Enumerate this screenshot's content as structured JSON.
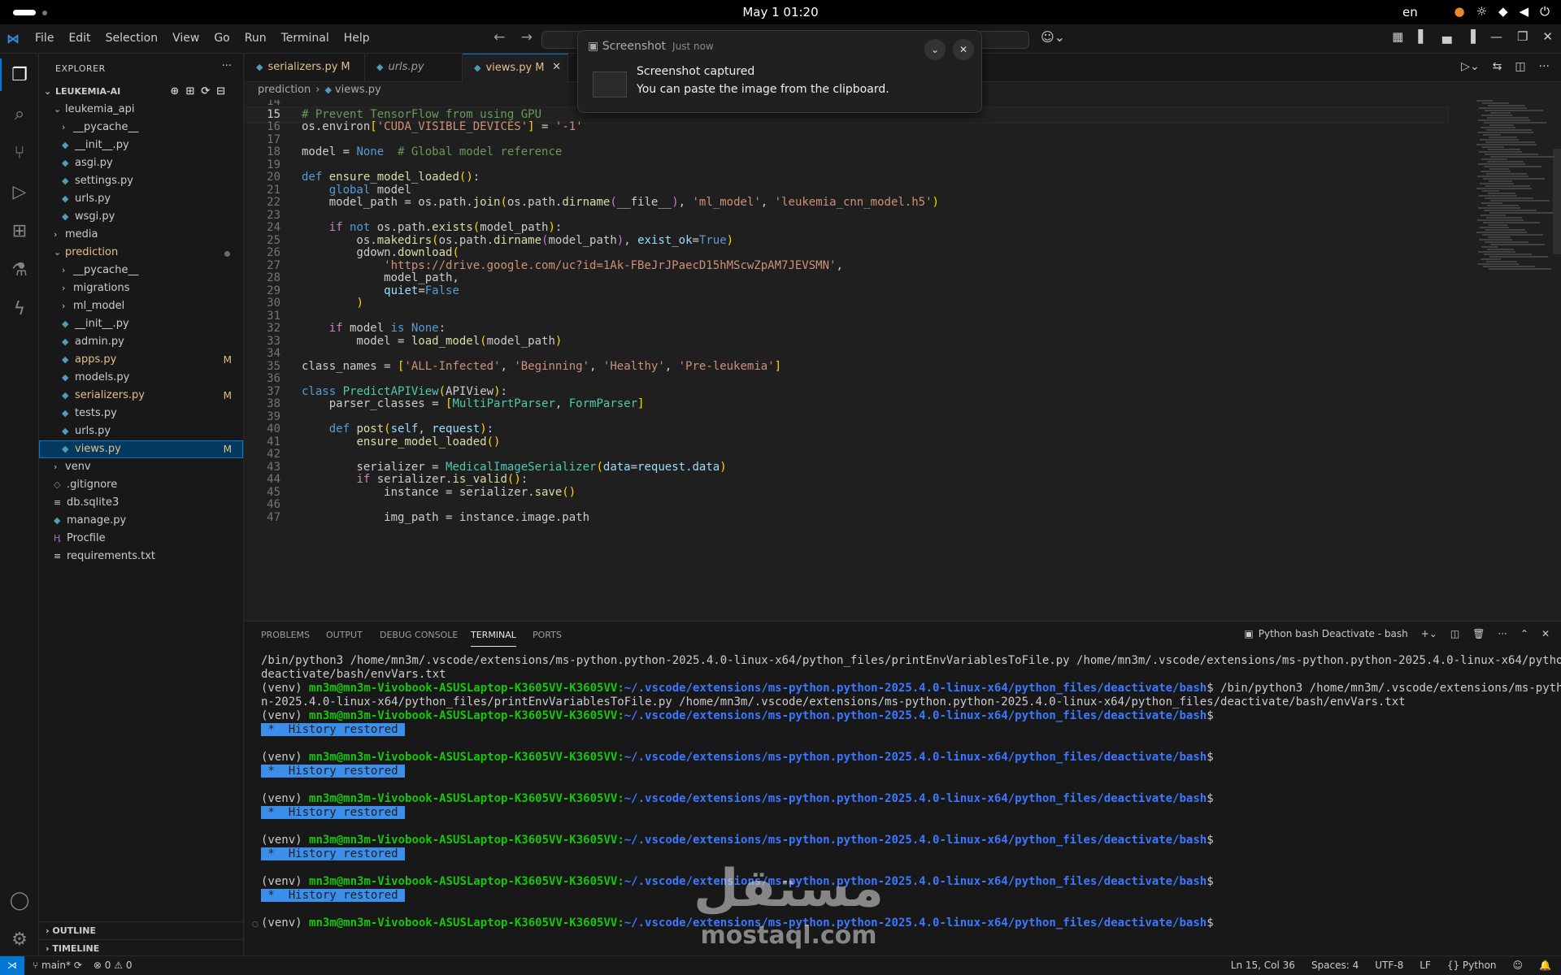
{
  "os": {
    "clock": "May 1  01:20",
    "lang": "en",
    "tray_icons": [
      "microphone-icon",
      "brightness-icon",
      "wifi-icon",
      "volume-icon",
      "power-icon"
    ]
  },
  "menu": [
    "File",
    "Edit",
    "Selection",
    "View",
    "Go",
    "Run",
    "Terminal",
    "Help"
  ],
  "sidebar": {
    "title": "EXPLORER",
    "root": "LEUKEMIA-AI",
    "items": [
      {
        "label": "leukemia_api",
        "depth": 1,
        "type": "folder-open"
      },
      {
        "label": "__pycache__",
        "depth": 2,
        "type": "folder"
      },
      {
        "label": "__init__.py",
        "depth": 2,
        "type": "py"
      },
      {
        "label": "asgi.py",
        "depth": 2,
        "type": "py"
      },
      {
        "label": "settings.py",
        "depth": 2,
        "type": "py"
      },
      {
        "label": "urls.py",
        "depth": 2,
        "type": "py"
      },
      {
        "label": "wsgi.py",
        "depth": 2,
        "type": "py"
      },
      {
        "label": "media",
        "depth": 1,
        "type": "folder"
      },
      {
        "label": "prediction",
        "depth": 1,
        "type": "folder-open",
        "status": "dot"
      },
      {
        "label": "__pycache__",
        "depth": 2,
        "type": "folder"
      },
      {
        "label": "migrations",
        "depth": 2,
        "type": "folder"
      },
      {
        "label": "ml_model",
        "depth": 2,
        "type": "folder"
      },
      {
        "label": "__init__.py",
        "depth": 2,
        "type": "py"
      },
      {
        "label": "admin.py",
        "depth": 2,
        "type": "py"
      },
      {
        "label": "apps.py",
        "depth": 2,
        "type": "py",
        "status": "M"
      },
      {
        "label": "models.py",
        "depth": 2,
        "type": "py"
      },
      {
        "label": "serializers.py",
        "depth": 2,
        "type": "py",
        "status": "M"
      },
      {
        "label": "tests.py",
        "depth": 2,
        "type": "py"
      },
      {
        "label": "urls.py",
        "depth": 2,
        "type": "py"
      },
      {
        "label": "views.py",
        "depth": 2,
        "type": "py",
        "status": "M",
        "selected": true
      },
      {
        "label": "venv",
        "depth": 1,
        "type": "folder"
      },
      {
        "label": ".gitignore",
        "depth": 1,
        "type": "git"
      },
      {
        "label": "db.sqlite3",
        "depth": 1,
        "type": "db"
      },
      {
        "label": "manage.py",
        "depth": 1,
        "type": "py"
      },
      {
        "label": "Procfile",
        "depth": 1,
        "type": "proc"
      },
      {
        "label": "requirements.txt",
        "depth": 1,
        "type": "txt"
      }
    ],
    "outline": "OUTLINE",
    "timeline": "TIMELINE"
  },
  "tabs": [
    {
      "label": "serializers.py",
      "modified": "M"
    },
    {
      "label": "urls.py",
      "modified": ""
    },
    {
      "label": "views.py",
      "modified": "M",
      "active": true
    }
  ],
  "breadcrumb": [
    "prediction",
    "views.py"
  ],
  "editor": {
    "current_line": 15,
    "lines": [
      {
        "n": "14",
        "code": ""
      },
      {
        "n": "15",
        "code": "# Prevent TensorFlow from using GPU"
      },
      {
        "n": "16",
        "code": "os.environ['CUDA_VISIBLE_DEVICES'] = '-1'"
      },
      {
        "n": "17",
        "code": ""
      },
      {
        "n": "18",
        "code": "model = None  # Global model reference"
      },
      {
        "n": "19",
        "code": ""
      },
      {
        "n": "20",
        "code": "def ensure_model_loaded():"
      },
      {
        "n": "21",
        "code": "    global model"
      },
      {
        "n": "22",
        "code": "    model_path = os.path.join(os.path.dirname(__file__), 'ml_model', 'leukemia_cnn_model.h5')"
      },
      {
        "n": "23",
        "code": ""
      },
      {
        "n": "24",
        "code": "    if not os.path.exists(model_path):"
      },
      {
        "n": "25",
        "code": "        os.makedirs(os.path.dirname(model_path), exist_ok=True)"
      },
      {
        "n": "26",
        "code": "        gdown.download("
      },
      {
        "n": "27",
        "code": "            'https://drive.google.com/uc?id=1Ak-FBeJrJPaecD15hMScwZpAM7JEVSMN',"
      },
      {
        "n": "28",
        "code": "            model_path,"
      },
      {
        "n": "29",
        "code": "            quiet=False"
      },
      {
        "n": "30",
        "code": "        )"
      },
      {
        "n": "31",
        "code": ""
      },
      {
        "n": "32",
        "code": "    if model is None:"
      },
      {
        "n": "33",
        "code": "        model = load_model(model_path)"
      },
      {
        "n": "34",
        "code": ""
      },
      {
        "n": "35",
        "code": "class_names = ['ALL-Infected', 'Beginning', 'Healthy', 'Pre-leukemia']"
      },
      {
        "n": "36",
        "code": ""
      },
      {
        "n": "37",
        "code": "class PredictAPIView(APIView):"
      },
      {
        "n": "38",
        "code": "    parser_classes = [MultiPartParser, FormParser]"
      },
      {
        "n": "39",
        "code": ""
      },
      {
        "n": "40",
        "code": "    def post(self, request):"
      },
      {
        "n": "41",
        "code": "        ensure_model_loaded()"
      },
      {
        "n": "42",
        "code": ""
      },
      {
        "n": "43",
        "code": "        serializer = MedicalImageSerializer(data=request.data)"
      },
      {
        "n": "44",
        "code": "        if serializer.is_valid():"
      },
      {
        "n": "45",
        "code": "            instance = serializer.save()"
      },
      {
        "n": "46",
        "code": ""
      },
      {
        "n": "47",
        "code": "            img_path = instance.image.path"
      }
    ]
  },
  "panel": {
    "tabs": [
      "PROBLEMS",
      "OUTPUT",
      "DEBUG CONSOLE",
      "TERMINAL",
      "PORTS"
    ],
    "active_tab": "TERMINAL",
    "terminal_name": "Python bash Deactivate - bash",
    "terminal": {
      "line1": "/bin/python3 /home/mn3m/.vscode/extensions/ms-python.python-2025.4.0-linux-x64/python_files/printEnvVariablesToFile.py /home/mn3m/.vscode/extensions/ms-python.python-2025.4.0-linux-x64/python_files/",
      "line2": "deactivate/bash/envVars.txt",
      "venv": "(venv) ",
      "user": "mn3m@mn3m-Vivobook-ASUSLaptop-K3605VV-K3605VV",
      "colon": ":",
      "path": "~/.vscode/extensions/ms-python.python-2025.4.0-linux-x64/python_files/deactivate/bash",
      "dollar": "$",
      "cmd_a": " /bin/python3 /home/mn3m/.vscode/extensions/ms-python.pytho",
      "cmd_b": "n-2025.4.0-linux-x64/python_files/printEnvVariablesToFile.py /home/mn3m/.vscode/extensions/ms-python.python-2025.4.0-linux-x64/python_files/deactivate/bash/envVars.txt",
      "history": " *  History restored "
    }
  },
  "notification": {
    "app": "Screenshot",
    "when": "Just now",
    "title": "Screenshot captured",
    "body": "You can paste the image from the clipboard."
  },
  "watermark": {
    "arabic": "مستقل",
    "latin": "mostaql.com"
  },
  "status": {
    "branch": "main*",
    "errors": "0",
    "warnings": "0",
    "position": "Ln 15, Col 36",
    "spaces": "Spaces: 4",
    "encoding": "UTF-8",
    "eol": "LF",
    "language": "Python"
  },
  "colors": {
    "accent": "#0078d4",
    "modified": "#e2c08d",
    "terminal_user": "#16c60c",
    "terminal_path": "#3b78ff"
  }
}
